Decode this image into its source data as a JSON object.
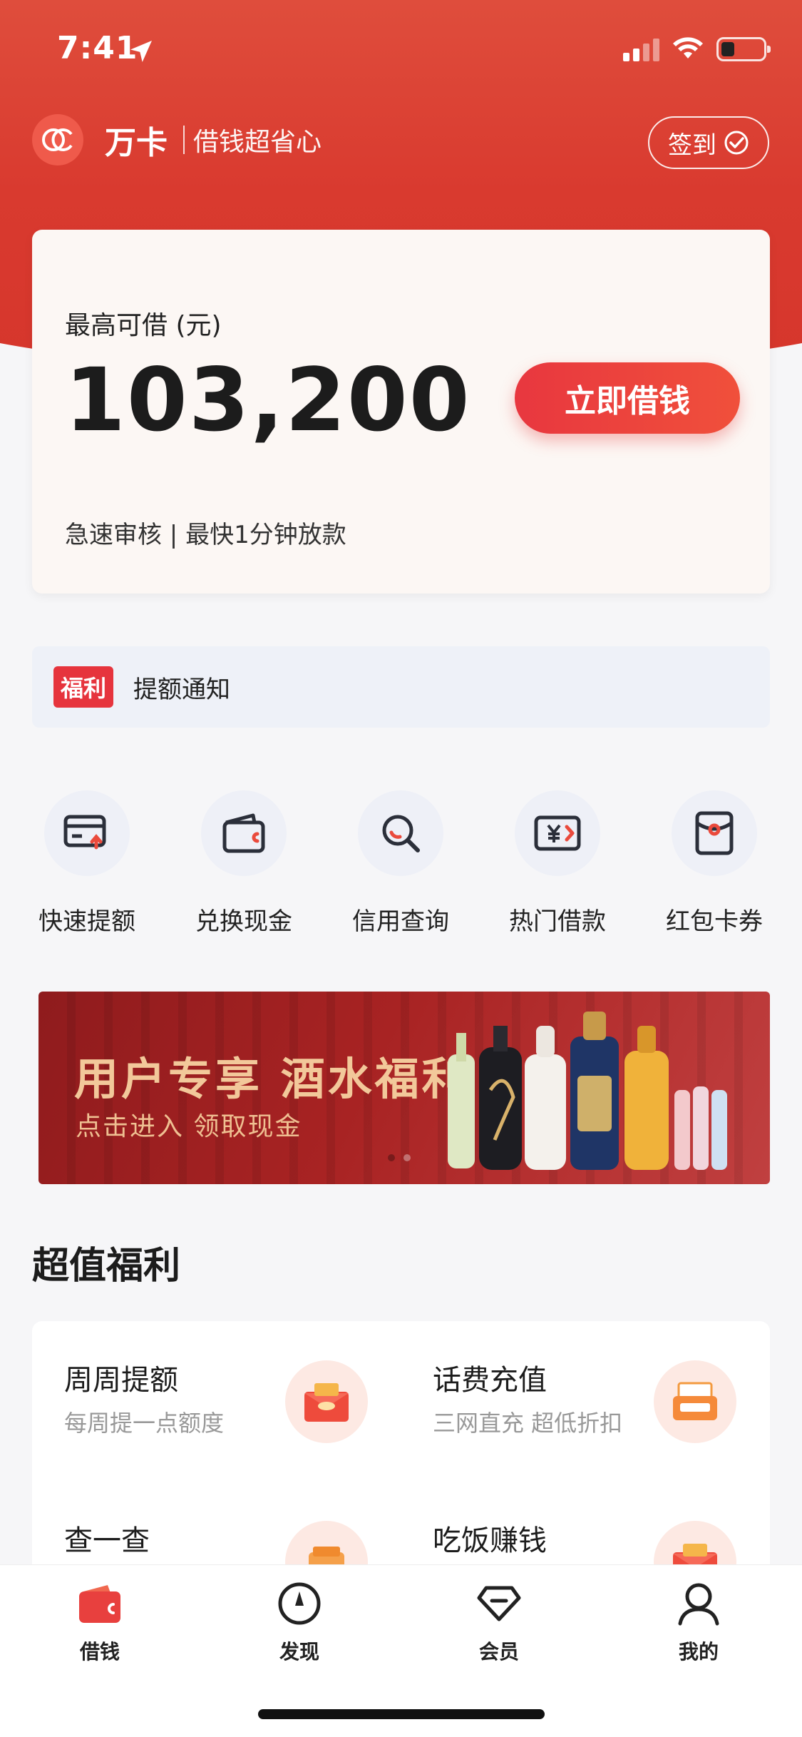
{
  "status_bar": {
    "time": "7:41"
  },
  "brand": {
    "name": "万卡",
    "slogan": "借钱超省心",
    "checkin_label": "签到"
  },
  "loan_card": {
    "label": "最高可借 (元)",
    "amount": "103,200",
    "cta": "立即借钱",
    "subtitle": "急速审核 | 最快1分钟放款"
  },
  "notice": {
    "badge": "福利",
    "text": "提额通知"
  },
  "actions": [
    {
      "label": "快速提额",
      "icon": "card-up-icon"
    },
    {
      "label": "兑换现金",
      "icon": "wallet-icon"
    },
    {
      "label": "信用查询",
      "icon": "search-icon"
    },
    {
      "label": "热门借款",
      "icon": "yen-ticket-icon"
    },
    {
      "label": "红包卡券",
      "icon": "red-envelope-icon"
    }
  ],
  "banner": {
    "title": "用户专享  酒水福利",
    "subtitle": "点击进入  领取现金"
  },
  "section": {
    "title": "超值福利"
  },
  "benefits": [
    {
      "title": "周周提额",
      "subtitle": "每周提一点额度",
      "icon": "red-envelope-gift-icon"
    },
    {
      "title": "话费充值",
      "subtitle": "三网直充 超低折扣",
      "icon": "phone-bill-icon"
    },
    {
      "title": "查一查",
      "subtitle": "",
      "icon": "wallet-card-icon"
    },
    {
      "title": "吃饭赚钱",
      "subtitle": "",
      "icon": "red-envelope-gift-icon"
    }
  ],
  "tabbar": [
    {
      "label": "借钱",
      "icon": "wallet-icon",
      "active": true
    },
    {
      "label": "发现",
      "icon": "compass-icon",
      "active": false
    },
    {
      "label": "会员",
      "icon": "diamond-icon",
      "active": false
    },
    {
      "label": "我的",
      "icon": "user-icon",
      "active": false
    }
  ],
  "colors": {
    "brand_red": "#d93a2f",
    "cta_red": "#e8373f",
    "card_bg": "#fcf7f4",
    "notice_bg": "#eef1f8"
  }
}
